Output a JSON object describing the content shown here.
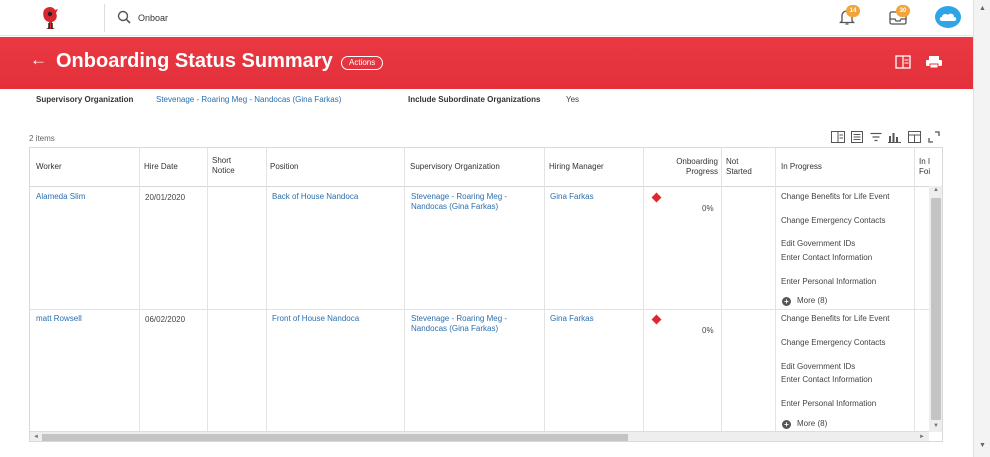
{
  "topbar": {
    "search_value": "Onboar",
    "notifications_count": "14",
    "inbox_count": "30"
  },
  "header": {
    "title": "Onboarding Status Summary",
    "actions_label": "Actions"
  },
  "filters": {
    "org_label": "Supervisory Organization",
    "org_value": "Stevenage - Roaring Meg - Nandocas (Gina Farkas)",
    "subordinate_label": "Include Subordinate Organizations",
    "subordinate_value": "Yes"
  },
  "table": {
    "count": "2 items",
    "columns": {
      "worker": "Worker",
      "hire_date": "Hire Date",
      "short_notice_1": "Short",
      "short_notice_2": "Notice",
      "position": "Position",
      "sup_org": "Supervisory Organization",
      "hiring_manager": "Hiring Manager",
      "progress_1": "Onboarding",
      "progress_2": "Progress",
      "not_started_1": "Not",
      "not_started_2": "Started",
      "in_progress": "In Progress",
      "last_1": "In I",
      "last_2": "Foi"
    },
    "rows": [
      {
        "worker": "Alameda Slim",
        "hire_date": "20/01/2020",
        "position": "Back of House Nandoca",
        "sup_org_1": "Stevenage - Roaring Meg -",
        "sup_org_2": "Nandocas (Gina Farkas)",
        "hiring_manager": "Gina Farkas",
        "progress": "0%",
        "in_progress": [
          "Change Benefits for Life Event",
          "Change Emergency Contacts",
          "Edit Government IDs",
          "Enter Contact Information",
          "Enter Personal Information"
        ],
        "more": "More (8)"
      },
      {
        "worker": "matt Rowsell",
        "hire_date": "06/02/2020",
        "position": "Front of House Nandoca",
        "sup_org_1": "Stevenage - Roaring Meg -",
        "sup_org_2": "Nandocas (Gina Farkas)",
        "hiring_manager": "Gina Farkas",
        "progress": "0%",
        "in_progress": [
          "Change Benefits for Life Event",
          "Change Emergency Contacts",
          "Edit Government IDs",
          "Enter Contact Information",
          "Enter Personal Information"
        ],
        "more": "More (8)"
      }
    ]
  },
  "colors": {
    "brand_red": "#e8343f",
    "link_blue": "#2a6fb0",
    "badge_orange": "#f2a33a",
    "cloud_blue": "#2fa4e7"
  },
  "icons": [
    "logo-icon",
    "search-icon",
    "bell-icon",
    "inbox-icon",
    "cloud-icon",
    "back-arrow-icon",
    "export-excel-icon",
    "print-icon",
    "column-view-icon",
    "table-view-icon",
    "filter-icon",
    "chart-icon",
    "layout-icon",
    "fullscreen-icon",
    "diamond-status-icon",
    "more-plus-icon"
  ]
}
